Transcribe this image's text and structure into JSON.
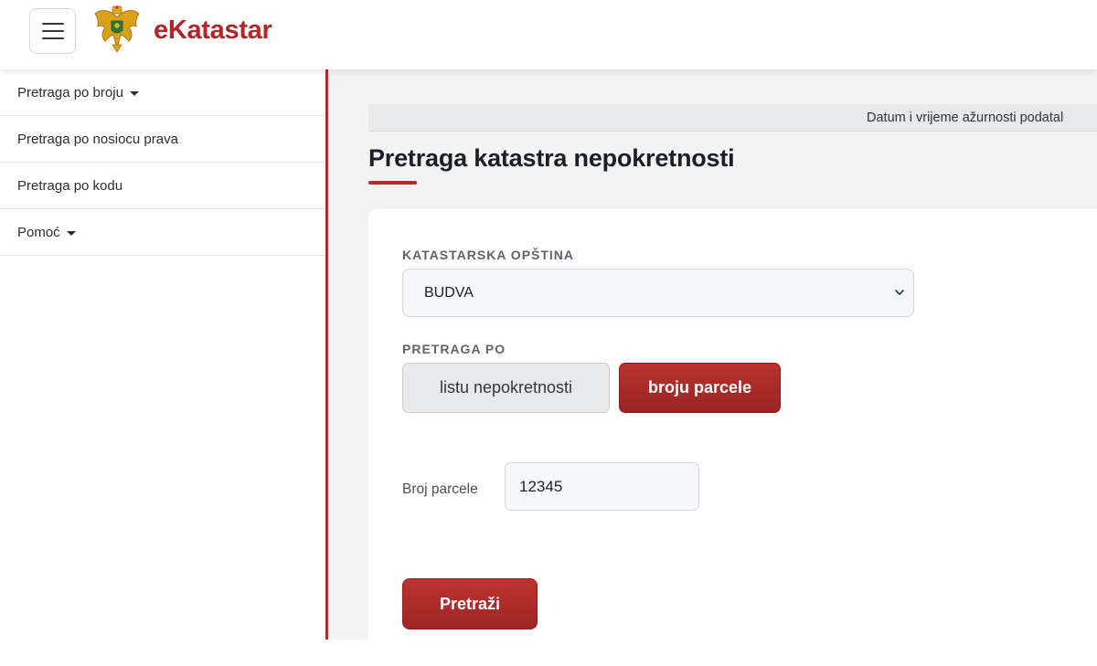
{
  "header": {
    "brand": "eKatastar",
    "logo": "montenegro-coat-of-arms",
    "menu_icon": "hamburger-icon"
  },
  "sidebar": {
    "items": [
      {
        "label": "Pretraga po broju",
        "has_caret": true
      },
      {
        "label": "Pretraga po nosiocu prava",
        "has_caret": false
      },
      {
        "label": "Pretraga po kodu",
        "has_caret": false
      },
      {
        "label": "Pomoć",
        "has_caret": true
      }
    ]
  },
  "main": {
    "update_text": "Datum i vrijeme ažurnosti podatal",
    "title": "Pretraga katastra nepokretnosti",
    "form": {
      "municipality_label": "KATASTARSKA OPŠTINA",
      "municipality_value": "BUDVA",
      "search_by_label": "PRETRAGA PO",
      "toggle_options": [
        "listu nepokretnosti",
        "broju parcele"
      ],
      "toggle_selected": "broju parcele",
      "parcel_label": "Broj parcele",
      "parcel_value": "12345",
      "submit_label": "Pretraži"
    }
  },
  "colors": {
    "accent": "#b52a2e",
    "brand": "#b0262b",
    "main_bg": "#f3f3f4"
  }
}
